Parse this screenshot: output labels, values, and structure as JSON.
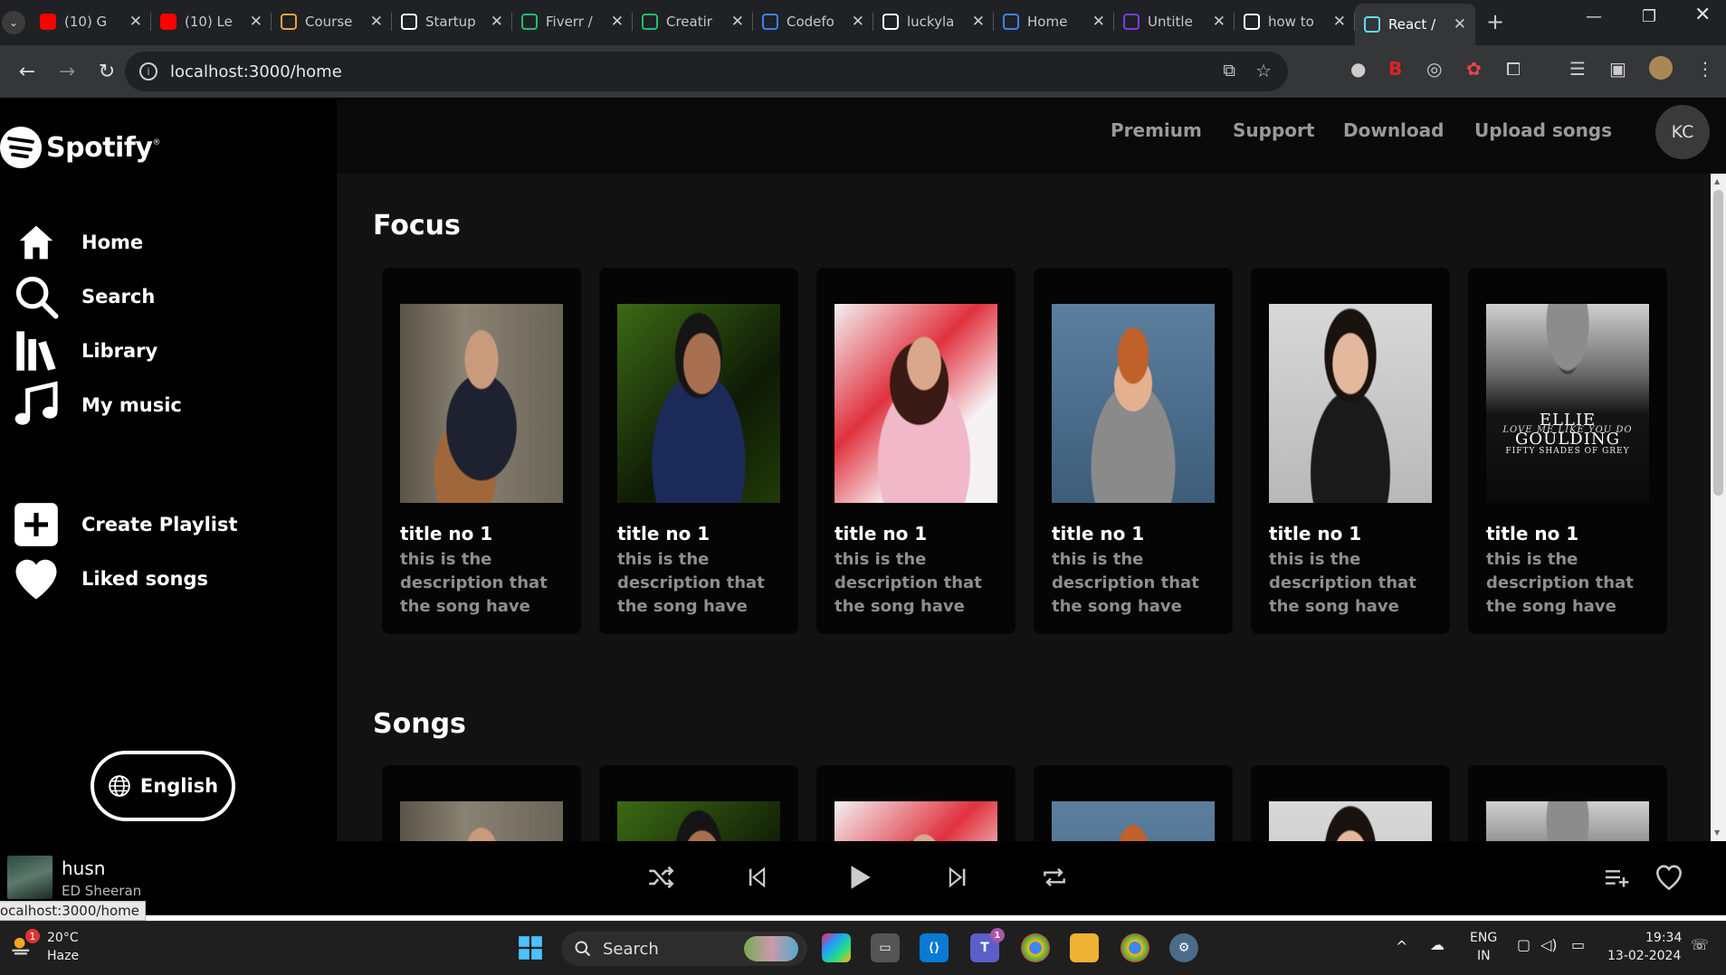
{
  "browser": {
    "tabs": [
      {
        "title": "(10) G",
        "icon": "youtube-icon",
        "color": "#ff0000"
      },
      {
        "title": "(10) Le",
        "icon": "youtube-icon",
        "color": "#ff0000"
      },
      {
        "title": "Course",
        "icon": "course-icon",
        "color": "#e8a33d"
      },
      {
        "title": "Startup",
        "icon": "w-icon",
        "color": "#ffffff"
      },
      {
        "title": "Fiverr /",
        "icon": "fiverr-icon",
        "color": "#1dbf73"
      },
      {
        "title": "Creatir",
        "icon": "fiverr-icon",
        "color": "#1dbf73"
      },
      {
        "title": "Codefo",
        "icon": "bar-chart-icon",
        "color": "#3b82f6"
      },
      {
        "title": "luckyla",
        "icon": "github-icon",
        "color": "#ffffff"
      },
      {
        "title": "Home",
        "icon": "c-icon",
        "color": "#3b82f6"
      },
      {
        "title": "Untitle",
        "icon": "canva-icon",
        "color": "#7c3aed"
      },
      {
        "title": "how to",
        "icon": "google-icon",
        "color": "#ffffff"
      },
      {
        "title": "React /",
        "icon": "react-icon",
        "color": "#61dafb"
      }
    ],
    "url": "localhost:3000/home",
    "hover_url": "ocalhost:3000/home"
  },
  "app": {
    "brand": "Spotify",
    "brand_mark": "®",
    "nav": [
      {
        "label": "Home",
        "icon": "home-icon"
      },
      {
        "label": "Search",
        "icon": "search-icon"
      },
      {
        "label": "Library",
        "icon": "library-icon"
      },
      {
        "label": "My music",
        "icon": "music-note-icon"
      }
    ],
    "actions": [
      {
        "label": "Create Playlist",
        "icon": "plus-square-icon"
      },
      {
        "label": "Liked songs",
        "icon": "heart-icon"
      }
    ],
    "language_button": "English",
    "topbar": {
      "links": [
        "Premium",
        "Support",
        "Download",
        "Upload songs"
      ],
      "avatar": "KC"
    },
    "sections": [
      {
        "title": "Focus",
        "cards": [
          {
            "title": "title no 1",
            "description": "this is the description that the song have",
            "art": "artist-1"
          },
          {
            "title": "title no 1",
            "description": "this is the description that the song have",
            "art": "artist-2"
          },
          {
            "title": "title no 1",
            "description": "this is the description that the song have",
            "art": "artist-3"
          },
          {
            "title": "title no 1",
            "description": "this is the description that the song have",
            "art": "artist-4"
          },
          {
            "title": "title no 1",
            "description": "this is the description that the song have",
            "art": "artist-5"
          },
          {
            "title": "title no 1",
            "description": "this is the description that the song have",
            "art": "album-ellie"
          }
        ]
      },
      {
        "title": "Songs",
        "cards": [
          {
            "art": "artist-1"
          },
          {
            "art": "artist-2"
          },
          {
            "art": "artist-3"
          },
          {
            "art": "artist-4"
          },
          {
            "art": "artist-5"
          },
          {
            "art": "album-ellie"
          }
        ]
      }
    ],
    "album_text": {
      "line1": "ELLIE GOULDING",
      "line2": "LOVE ME LIKE YOU DO",
      "line3": "FIFTY SHADES OF GREY"
    },
    "now_playing": {
      "title": "husn",
      "artist": "ED Sheeran"
    },
    "controls": [
      "shuffle-icon",
      "previous-icon",
      "play-icon",
      "next-icon",
      "repeat-icon"
    ]
  },
  "taskbar": {
    "weather": {
      "temp": "20°C",
      "condition": "Haze",
      "badge": "1"
    },
    "search_placeholder": "Search",
    "language": {
      "line1": "ENG",
      "line2": "IN"
    },
    "time": "19:34",
    "date": "13-02-2024",
    "teams_badge": "1"
  }
}
